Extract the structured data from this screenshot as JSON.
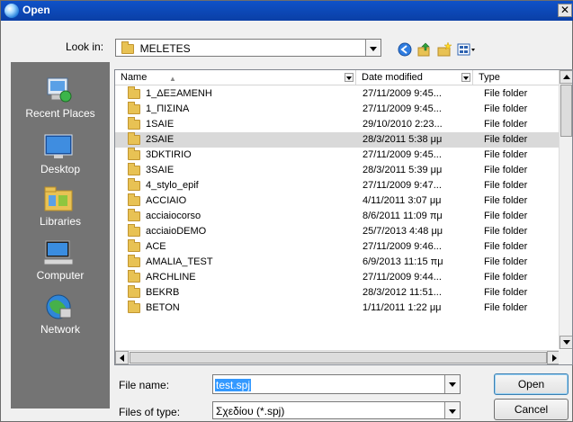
{
  "window": {
    "title": "Open",
    "close_glyph": "✕"
  },
  "look_in": {
    "label": "Look in:",
    "value": "MELETES"
  },
  "places": [
    {
      "id": "recent",
      "label": "Recent Places",
      "icon": "recent-places-icon"
    },
    {
      "id": "desktop",
      "label": "Desktop",
      "icon": "desktop-icon"
    },
    {
      "id": "libraries",
      "label": "Libraries",
      "icon": "libraries-icon"
    },
    {
      "id": "computer",
      "label": "Computer",
      "icon": "computer-icon"
    },
    {
      "id": "network",
      "label": "Network",
      "icon": "network-icon"
    }
  ],
  "columns": {
    "name": "Name",
    "date": "Date modified",
    "type": "Type"
  },
  "files": [
    {
      "name": "1_ΔΕΞΑΜΕΝΗ",
      "date": "27/11/2009 9:45...",
      "type": "File folder"
    },
    {
      "name": "1_ΠΙΣΙΝΑ",
      "date": "27/11/2009 9:45...",
      "type": "File folder"
    },
    {
      "name": "1SAIE",
      "date": "29/10/2010 2:23...",
      "type": "File folder"
    },
    {
      "name": "2SAIE",
      "date": "28/3/2011 5:38 μμ",
      "type": "File folder"
    },
    {
      "name": "3DKTIRIO",
      "date": "27/11/2009 9:45...",
      "type": "File folder"
    },
    {
      "name": "3SAIE",
      "date": "28/3/2011 5:39 μμ",
      "type": "File folder"
    },
    {
      "name": "4_stylo_epif",
      "date": "27/11/2009 9:47...",
      "type": "File folder"
    },
    {
      "name": "ACCIAIO",
      "date": "4/11/2011 3:07 μμ",
      "type": "File folder"
    },
    {
      "name": "acciaiocorso",
      "date": "8/6/2011 11:09 πμ",
      "type": "File folder"
    },
    {
      "name": "acciaioDEMO",
      "date": "25/7/2013 4:48 μμ",
      "type": "File folder"
    },
    {
      "name": "ACE",
      "date": "27/11/2009 9:46...",
      "type": "File folder"
    },
    {
      "name": "AMALIA_TEST",
      "date": "6/9/2013 11:15 πμ",
      "type": "File folder"
    },
    {
      "name": "ARCHLINE",
      "date": "27/11/2009 9:44...",
      "type": "File folder"
    },
    {
      "name": "BEKRB",
      "date": "28/3/2012 11:51...",
      "type": "File folder"
    },
    {
      "name": "BETON",
      "date": "1/11/2011 1:22 μμ",
      "type": "File folder"
    }
  ],
  "selected_row": 3,
  "file_name": {
    "label": "File name:",
    "value": "test.spj"
  },
  "file_type": {
    "label": "Files of type:",
    "value": "Σχεδίου (*.spj)"
  },
  "buttons": {
    "open": "Open",
    "cancel": "Cancel"
  },
  "colors": {
    "titlebar": "#0a3fa6",
    "places_bg": "#747474",
    "selection": "#d9d9d9",
    "text_selection": "#3399ff"
  }
}
